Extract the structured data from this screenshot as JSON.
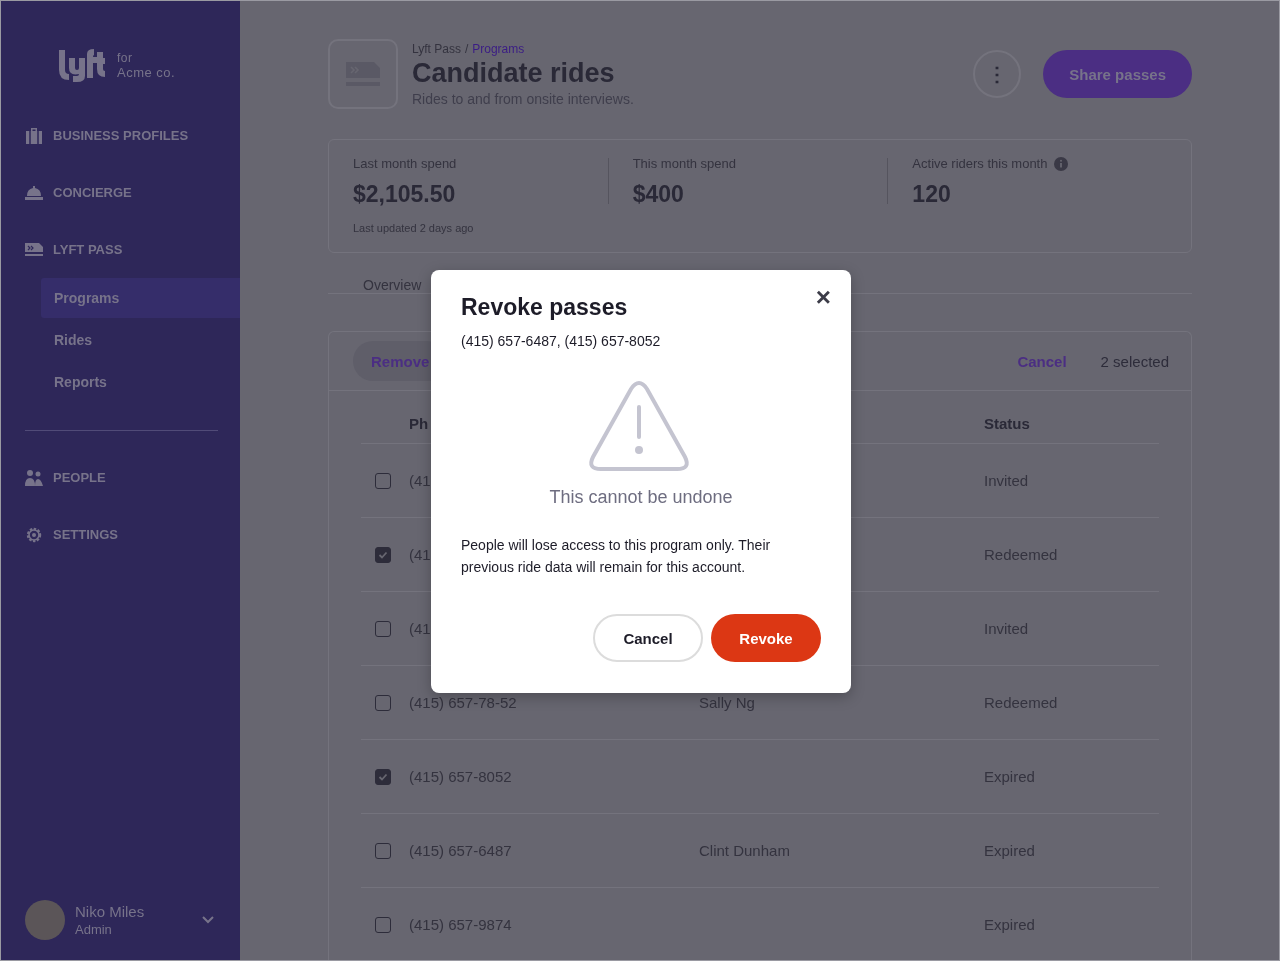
{
  "sidebar": {
    "logo": {
      "for": "for",
      "company": "Acme co."
    },
    "nav_groups": [
      [
        {
          "label": "BUSINESS PROFILES"
        },
        {
          "label": "CONCIERGE"
        },
        {
          "label": "LYFT PASS",
          "children": [
            {
              "label": "Programs",
              "selected": true
            },
            {
              "label": "Rides",
              "selected": false
            },
            {
              "label": "Reports",
              "selected": false
            }
          ]
        }
      ],
      [
        {
          "label": "PEOPLE"
        },
        {
          "label": "SETTINGS"
        }
      ]
    ],
    "user": {
      "name": "Niko Miles",
      "role": "Admin"
    }
  },
  "header": {
    "breadcrumb": {
      "parent": "Lyft Pass",
      "separator": "/",
      "current": "Programs"
    },
    "title": "Candidate rides",
    "subtitle": "Rides to and from onsite interviews.",
    "more_button": "⋮",
    "share_button": "Share passes"
  },
  "stats": [
    {
      "label": "Last month spend",
      "value": "$2,105.50",
      "note": "Last updated 2 days ago"
    },
    {
      "label": "This month spend",
      "value": "$400"
    },
    {
      "label": "Active riders this month",
      "value": "120",
      "info": true
    }
  ],
  "tabs": [
    {
      "label": "Overview",
      "selected": false
    }
  ],
  "table": {
    "toolbar": {
      "remove": "Remove",
      "cancel": "Cancel",
      "selected_count": "2 selected"
    },
    "columns": [
      "Ph",
      "",
      "Status"
    ],
    "rows": [
      {
        "checked": false,
        "phone": "(41",
        "status": "Invited"
      },
      {
        "checked": true,
        "phone": "(41",
        "status": "Redeemed"
      },
      {
        "checked": false,
        "phone": "(41",
        "status": "Invited"
      },
      {
        "checked": false,
        "phone": "(415) 657-78-52",
        "name": "Sally Ng",
        "status": "Redeemed"
      },
      {
        "checked": true,
        "phone": "(415) 657-8052",
        "status": "Expired"
      },
      {
        "checked": false,
        "phone": "(415) 657-6487",
        "name": "Clint Dunham",
        "status": "Expired"
      },
      {
        "checked": false,
        "phone": "(415) 657-9874",
        "status": "Expired"
      }
    ]
  },
  "modal": {
    "title": "Revoke passes",
    "subtitle": "(415) 657-6487, (415) 657-8052",
    "warning": "This cannot be undone",
    "body": "People will lose access to this program only. Their previous ride data will remain for this account.",
    "close": "×",
    "cancel": "Cancel",
    "confirm": "Revoke"
  }
}
